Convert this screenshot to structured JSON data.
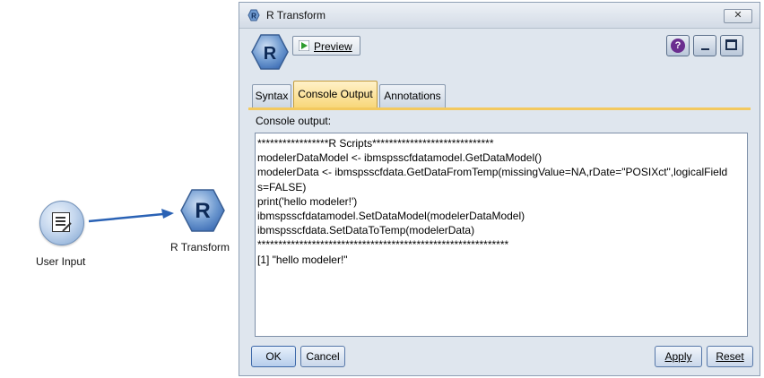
{
  "canvas": {
    "nodes": [
      {
        "label": "User Input",
        "icon": "document-edit-icon"
      },
      {
        "label": "R Transform",
        "icon": "r-hexagon-icon"
      }
    ],
    "link_color": "#2a62b5"
  },
  "dialog": {
    "title": "R Transform",
    "close_label": "✕",
    "toolbar": {
      "preview_label": "Preview",
      "help_label": "?"
    },
    "tabs": [
      {
        "label": "Syntax",
        "active": false
      },
      {
        "label": "Console Output",
        "active": true
      },
      {
        "label": "Annotations",
        "active": false
      }
    ],
    "console_label": "Console output:",
    "console_lines": [
      "*****************R Scripts*****************************",
      "modelerDataModel <- ibmspsscfdatamodel.GetDataModel()",
      "modelerData <- ibmspsscfdata.GetDataFromTemp(missingValue=NA,rDate=\"POSIXct\",logicalField",
      "s=FALSE)",
      "print('hello modeler!')",
      "ibmspsscfdatamodel.SetDataModel(modelerDataModel)",
      "ibmspsscfdata.SetDataToTemp(modelerData)",
      "************************************************************",
      "[1] \"hello modeler!\""
    ],
    "buttons": {
      "ok": "OK",
      "cancel": "Cancel",
      "apply": "Apply",
      "reset": "Reset"
    }
  },
  "colors": {
    "active_tab": "#f8d77a",
    "r_node": "#3f6fb6",
    "help_icon": "#6b2e8f"
  }
}
